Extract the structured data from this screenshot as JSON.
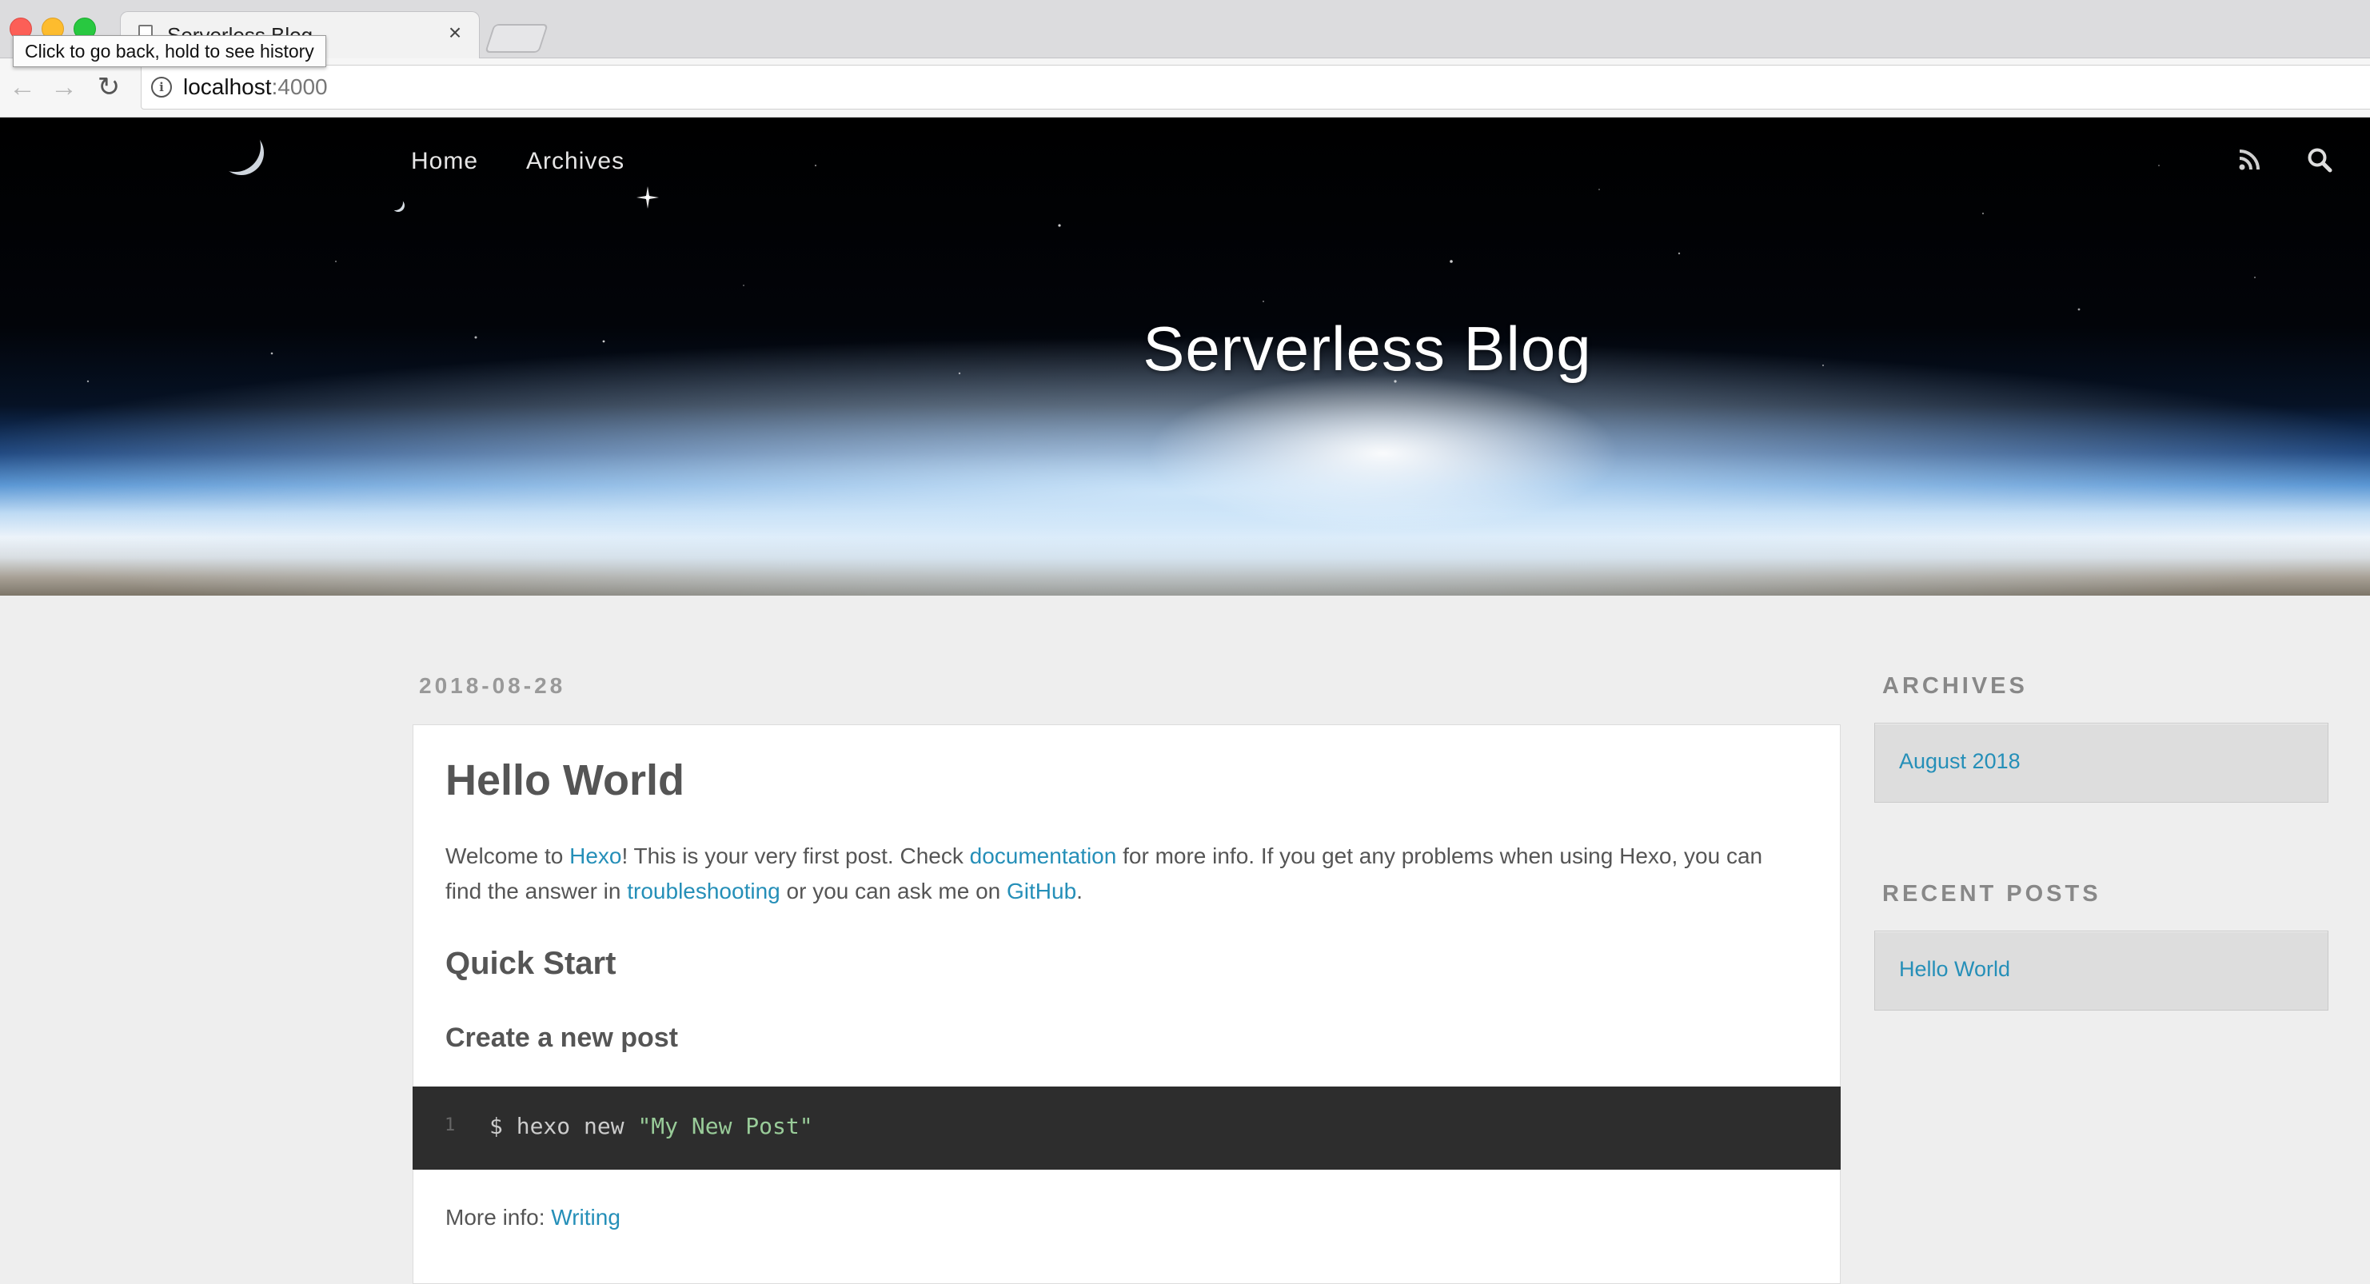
{
  "browser": {
    "tab_title": "Serverless Blog",
    "tab_close": "×",
    "tooltip": "Click to go back, hold to see history",
    "url_host": "localhost",
    "url_port": ":4000",
    "back_glyph": "←",
    "forward_glyph": "→",
    "reload_glyph": "↻"
  },
  "site": {
    "nav": [
      "Home",
      "Archives"
    ],
    "title": "Serverless Blog",
    "icons": [
      "rss-icon",
      "search-icon"
    ]
  },
  "post": {
    "date": "2018-08-28",
    "title": "Hello World",
    "intro": {
      "t1": "Welcome to ",
      "link_hexo": "Hexo",
      "t2": "! This is your very first post. Check ",
      "link_docs": "documentation",
      "t3": " for more info. If you get any problems when using Hexo, you can find the answer in ",
      "link_trouble": "troubleshooting",
      "t4": " or you can ask me on ",
      "link_github": "GitHub",
      "t5": "."
    },
    "h2": "Quick Start",
    "h3": "Create a new post",
    "code": {
      "line_number": "1",
      "command": "$ hexo new ",
      "string": "\"My New Post\""
    },
    "more_info_label": "More info: ",
    "more_info_link": "Writing"
  },
  "sidebar": {
    "archives_title": "ARCHIVES",
    "archives_items": [
      "August 2018"
    ],
    "recent_title": "RECENT POSTS",
    "recent_items": [
      "Hello World"
    ]
  },
  "colors": {
    "link": "#258fb8",
    "page_bg": "#eeeeee",
    "code_bg": "#2d2d2d",
    "code_string": "#99cc99"
  }
}
